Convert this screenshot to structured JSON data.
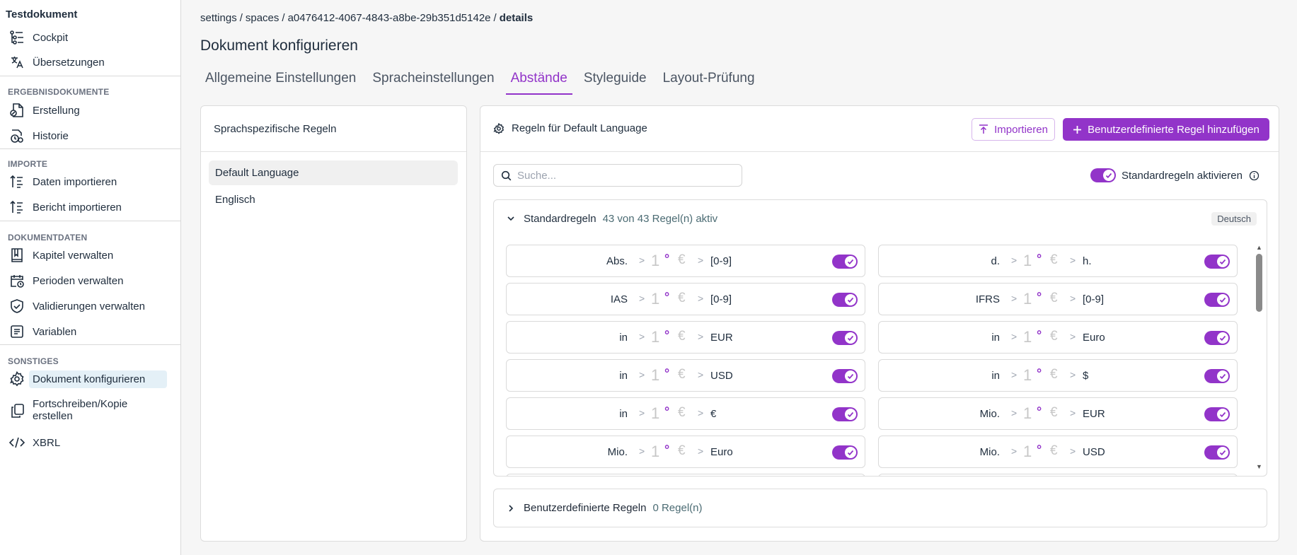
{
  "sidebar": {
    "title": "Testdokument",
    "items": [
      {
        "label": "Cockpit",
        "icon": "cockpit-icon"
      },
      {
        "label": "Übersetzungen",
        "icon": "translate-icon"
      },
      {
        "label": "Erstellung",
        "icon": "create-document-icon"
      },
      {
        "label": "Historie",
        "icon": "history-icon"
      },
      {
        "label": "Daten importieren",
        "icon": "import-list-icon"
      },
      {
        "label": "Bericht importieren",
        "icon": "import-list-icon"
      },
      {
        "label": "Kapitel verwalten",
        "icon": "book-icon"
      },
      {
        "label": "Perioden verwalten",
        "icon": "calendar-clock-icon"
      },
      {
        "label": "Validierungen verwalten",
        "icon": "shield-check-icon"
      },
      {
        "label": "Variablen",
        "icon": "variables-icon"
      },
      {
        "label": "Dokument konfigurieren",
        "icon": "gear-icon"
      },
      {
        "label": "Fortschreiben/Kopie erstellen",
        "icon": "copy-icon"
      },
      {
        "label": "XBRL",
        "icon": "code-icon"
      }
    ],
    "sections": [
      "ERGEBNISDOKUMENTE",
      "IMPORTE",
      "DOKUMENTDATEN",
      "SONSTIGES"
    ]
  },
  "breadcrumb": {
    "p1": "settings",
    "p2": "spaces",
    "p3": "a0476412-4067-4843-a8be-29b351d5142e",
    "current": "details",
    "sep": "/"
  },
  "page_title": "Dokument konfigurieren",
  "tabs": [
    "Allgemeine Einstellungen",
    "Spracheinstellungen",
    "Abstände",
    "Styleguide",
    "Layout-Prüfung"
  ],
  "left_panel": {
    "title": "Sprachspezifische Regeln",
    "languages": [
      "Default Language",
      "Englisch"
    ]
  },
  "right_panel": {
    "title": "Regeln für Default Language",
    "import_label": "Importieren",
    "add_label": "Benutzerdefinierte Regel hinzufügen",
    "search_placeholder": "Suche...",
    "std_activate_label": "Standardregeln aktivieren",
    "standard": {
      "name": "Standardregeln",
      "count": "43 von 43 Regel(n) aktiv",
      "badge": "Deutsch"
    },
    "custom": {
      "name": "Benutzerdefinierte Regeln",
      "count": "0 Regel(n)"
    },
    "example": {
      "one": "1",
      "deg": "°",
      "euro": "€",
      "arrow": ">"
    },
    "rules": [
      {
        "left": "Abs.",
        "right": "[0-9]"
      },
      {
        "left": "d.",
        "right": "h."
      },
      {
        "left": "IAS",
        "right": "[0-9]"
      },
      {
        "left": "IFRS",
        "right": "[0-9]"
      },
      {
        "left": "in",
        "right": "EUR"
      },
      {
        "left": "in",
        "right": "Euro"
      },
      {
        "left": "in",
        "right": "USD"
      },
      {
        "left": "in",
        "right": "$"
      },
      {
        "left": "in",
        "right": "€"
      },
      {
        "left": "Mio.",
        "right": "EUR"
      },
      {
        "left": "Mio.",
        "right": "Euro"
      },
      {
        "left": "Mio.",
        "right": "USD"
      }
    ]
  },
  "colors": {
    "accent": "#9234c9",
    "active_nav_bg": "#e4f0f7"
  }
}
